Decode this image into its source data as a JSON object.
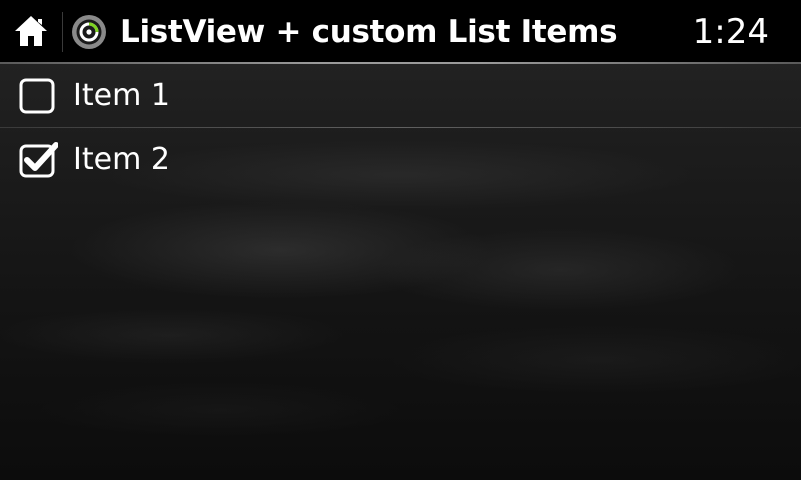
{
  "app": {
    "title": "ListView + custom List Items",
    "clock": "1:24"
  },
  "icons": {
    "home": "home-icon",
    "app": "app-logo-icon",
    "unchecked": "checkbox-unchecked-icon",
    "checked": "checkbox-checked-icon"
  },
  "colors": {
    "header_bg": "#000000",
    "text": "#ffffff",
    "app_icon_ring": "#8a8a8a",
    "app_icon_accent": "#7ed321"
  },
  "list": {
    "items": [
      {
        "label": "Item 1",
        "checked": false
      },
      {
        "label": "Item 2",
        "checked": true
      }
    ]
  }
}
